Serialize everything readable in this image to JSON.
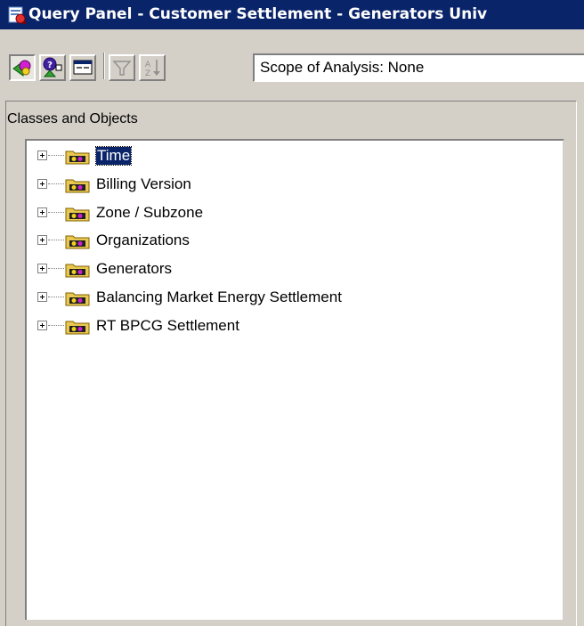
{
  "window": {
    "title": "Query Panel - Customer Settlement - Generators Univ"
  },
  "toolbar": {
    "buttons": [
      {
        "name": "classes-objects-view",
        "icon": "classes-objects-icon",
        "pressed": true
      },
      {
        "name": "predefined-conditions",
        "icon": "predefined-conditions-icon",
        "pressed": false
      },
      {
        "name": "sql-view",
        "icon": "window-icon",
        "pressed": false
      },
      {
        "name": "filter",
        "icon": "filter-icon",
        "pressed": false
      },
      {
        "name": "sort",
        "icon": "sort-icon",
        "pressed": false
      }
    ],
    "scope": "Scope of Analysis: None"
  },
  "panel": {
    "label": "Classes and Objects"
  },
  "tree": {
    "items": [
      {
        "label": "Time",
        "selected": true
      },
      {
        "label": "Billing Version",
        "selected": false
      },
      {
        "label": "Zone / Subzone",
        "selected": false
      },
      {
        "label": "Organizations",
        "selected": false
      },
      {
        "label": "Generators",
        "selected": false
      },
      {
        "label": "Balancing Market Energy Settlement",
        "selected": false
      },
      {
        "label": "RT BPCG Settlement",
        "selected": false
      }
    ]
  },
  "colors": {
    "titlebar": "#0a246a",
    "face": "#d4d0c8",
    "folder": "#e8c850"
  }
}
